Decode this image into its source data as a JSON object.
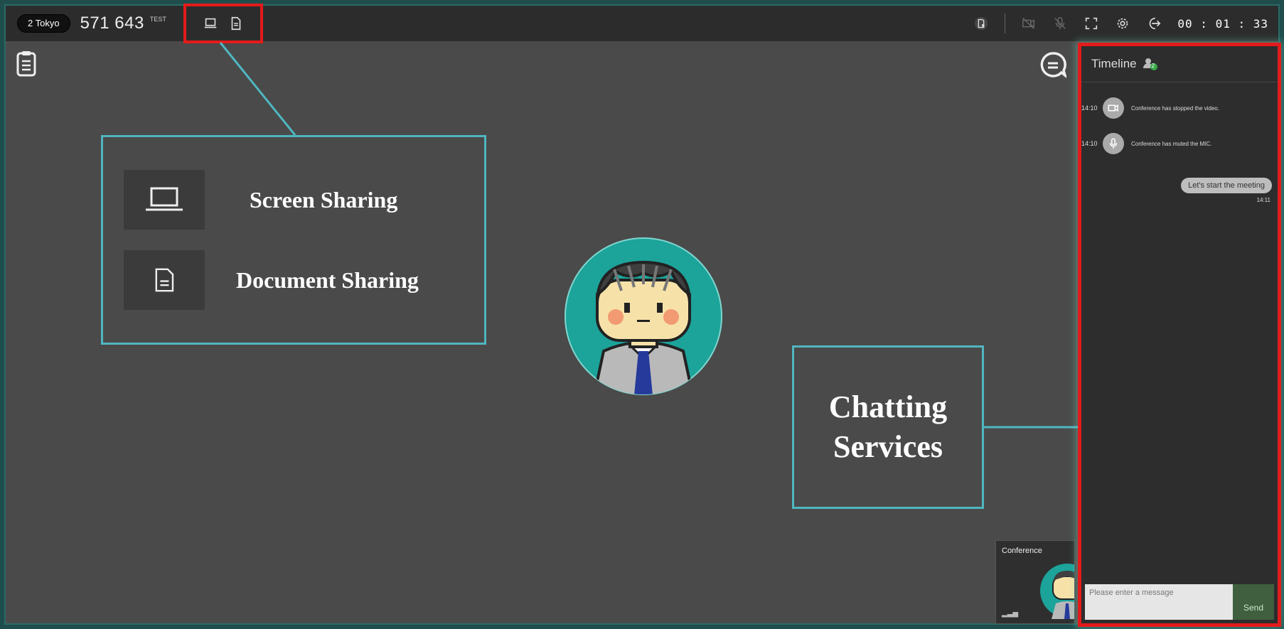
{
  "topbar": {
    "room_label": "2 Tokyo",
    "room_number": "571 643",
    "room_tag": "TEST",
    "timer": "00 : 01 : 33",
    "share_icons": [
      "laptop-screen-icon",
      "document-icon"
    ],
    "right_icons": [
      "doc-user-icon",
      "video-off-icon",
      "mic-off-icon",
      "fullscreen-icon",
      "settings-icon",
      "exit-icon"
    ]
  },
  "callout_sharing": {
    "screen_label": "Screen Sharing",
    "document_label": "Document Sharing"
  },
  "callout_chat": {
    "line1": "Chatting",
    "line2": "Services"
  },
  "chat": {
    "title": "Timeline",
    "participant_count": "2",
    "events": [
      {
        "time": "14:10",
        "icon": "video-off-icon",
        "text": "Conference has stopped the video."
      },
      {
        "time": "14:10",
        "icon": "mic-off-icon",
        "text": "Conference has muted the MIC."
      }
    ],
    "message": {
      "text": "Let's start the meeting",
      "time": "14:11"
    },
    "input_placeholder": "Please enter a message",
    "send_label": "Send"
  },
  "thumbnail": {
    "label": "Conference"
  },
  "colors": {
    "highlight_red": "#e41b1b",
    "callout_teal": "#4fb6c0",
    "avatar_teal": "#1ca39a"
  }
}
